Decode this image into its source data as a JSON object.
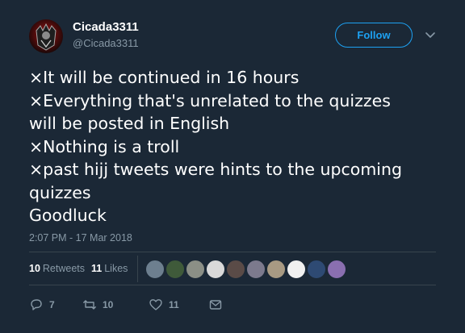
{
  "author": {
    "name": "Cicada3311",
    "handle": "@Cicada3311"
  },
  "follow_label": "Follow",
  "tweet_lines": [
    "×It will be continued in 16 hours",
    "×Everything that's unrelated to the quizzes",
    "will be posted in English",
    "×Nothing is a troll",
    "×past hijj tweets were hints to the upcoming",
    "quizzes",
    "Goodluck"
  ],
  "timestamp": "2:07 PM - 17 Mar 2018",
  "stats": {
    "retweets_count": "10",
    "retweets_label": "Retweets",
    "likes_count": "11",
    "likes_label": "Likes"
  },
  "liker_avatars": [
    {
      "name": "liker-1",
      "color": "#6d7f8f"
    },
    {
      "name": "liker-2",
      "color": "#3f5a3a"
    },
    {
      "name": "liker-3",
      "color": "#8b8f86"
    },
    {
      "name": "liker-4",
      "color": "#d9d9d9"
    },
    {
      "name": "liker-5",
      "color": "#5a4b47"
    },
    {
      "name": "liker-6",
      "color": "#7c7a8d"
    },
    {
      "name": "liker-7",
      "color": "#a89a83"
    },
    {
      "name": "liker-8",
      "color": "#f0f0f0"
    },
    {
      "name": "liker-9",
      "color": "#2e4a73"
    },
    {
      "name": "liker-10",
      "color": "#8a6fb0"
    }
  ],
  "actions": {
    "reply_count": "7",
    "retweet_count": "10",
    "like_count": "11"
  },
  "colors": {
    "background": "#1b2836",
    "accent": "#1da1f2",
    "secondary_text": "#8899a6",
    "divider": "#38444d"
  },
  "icons": [
    "reply-icon",
    "retweet-icon",
    "like-icon",
    "direct-message-icon",
    "chevron-down-icon"
  ]
}
